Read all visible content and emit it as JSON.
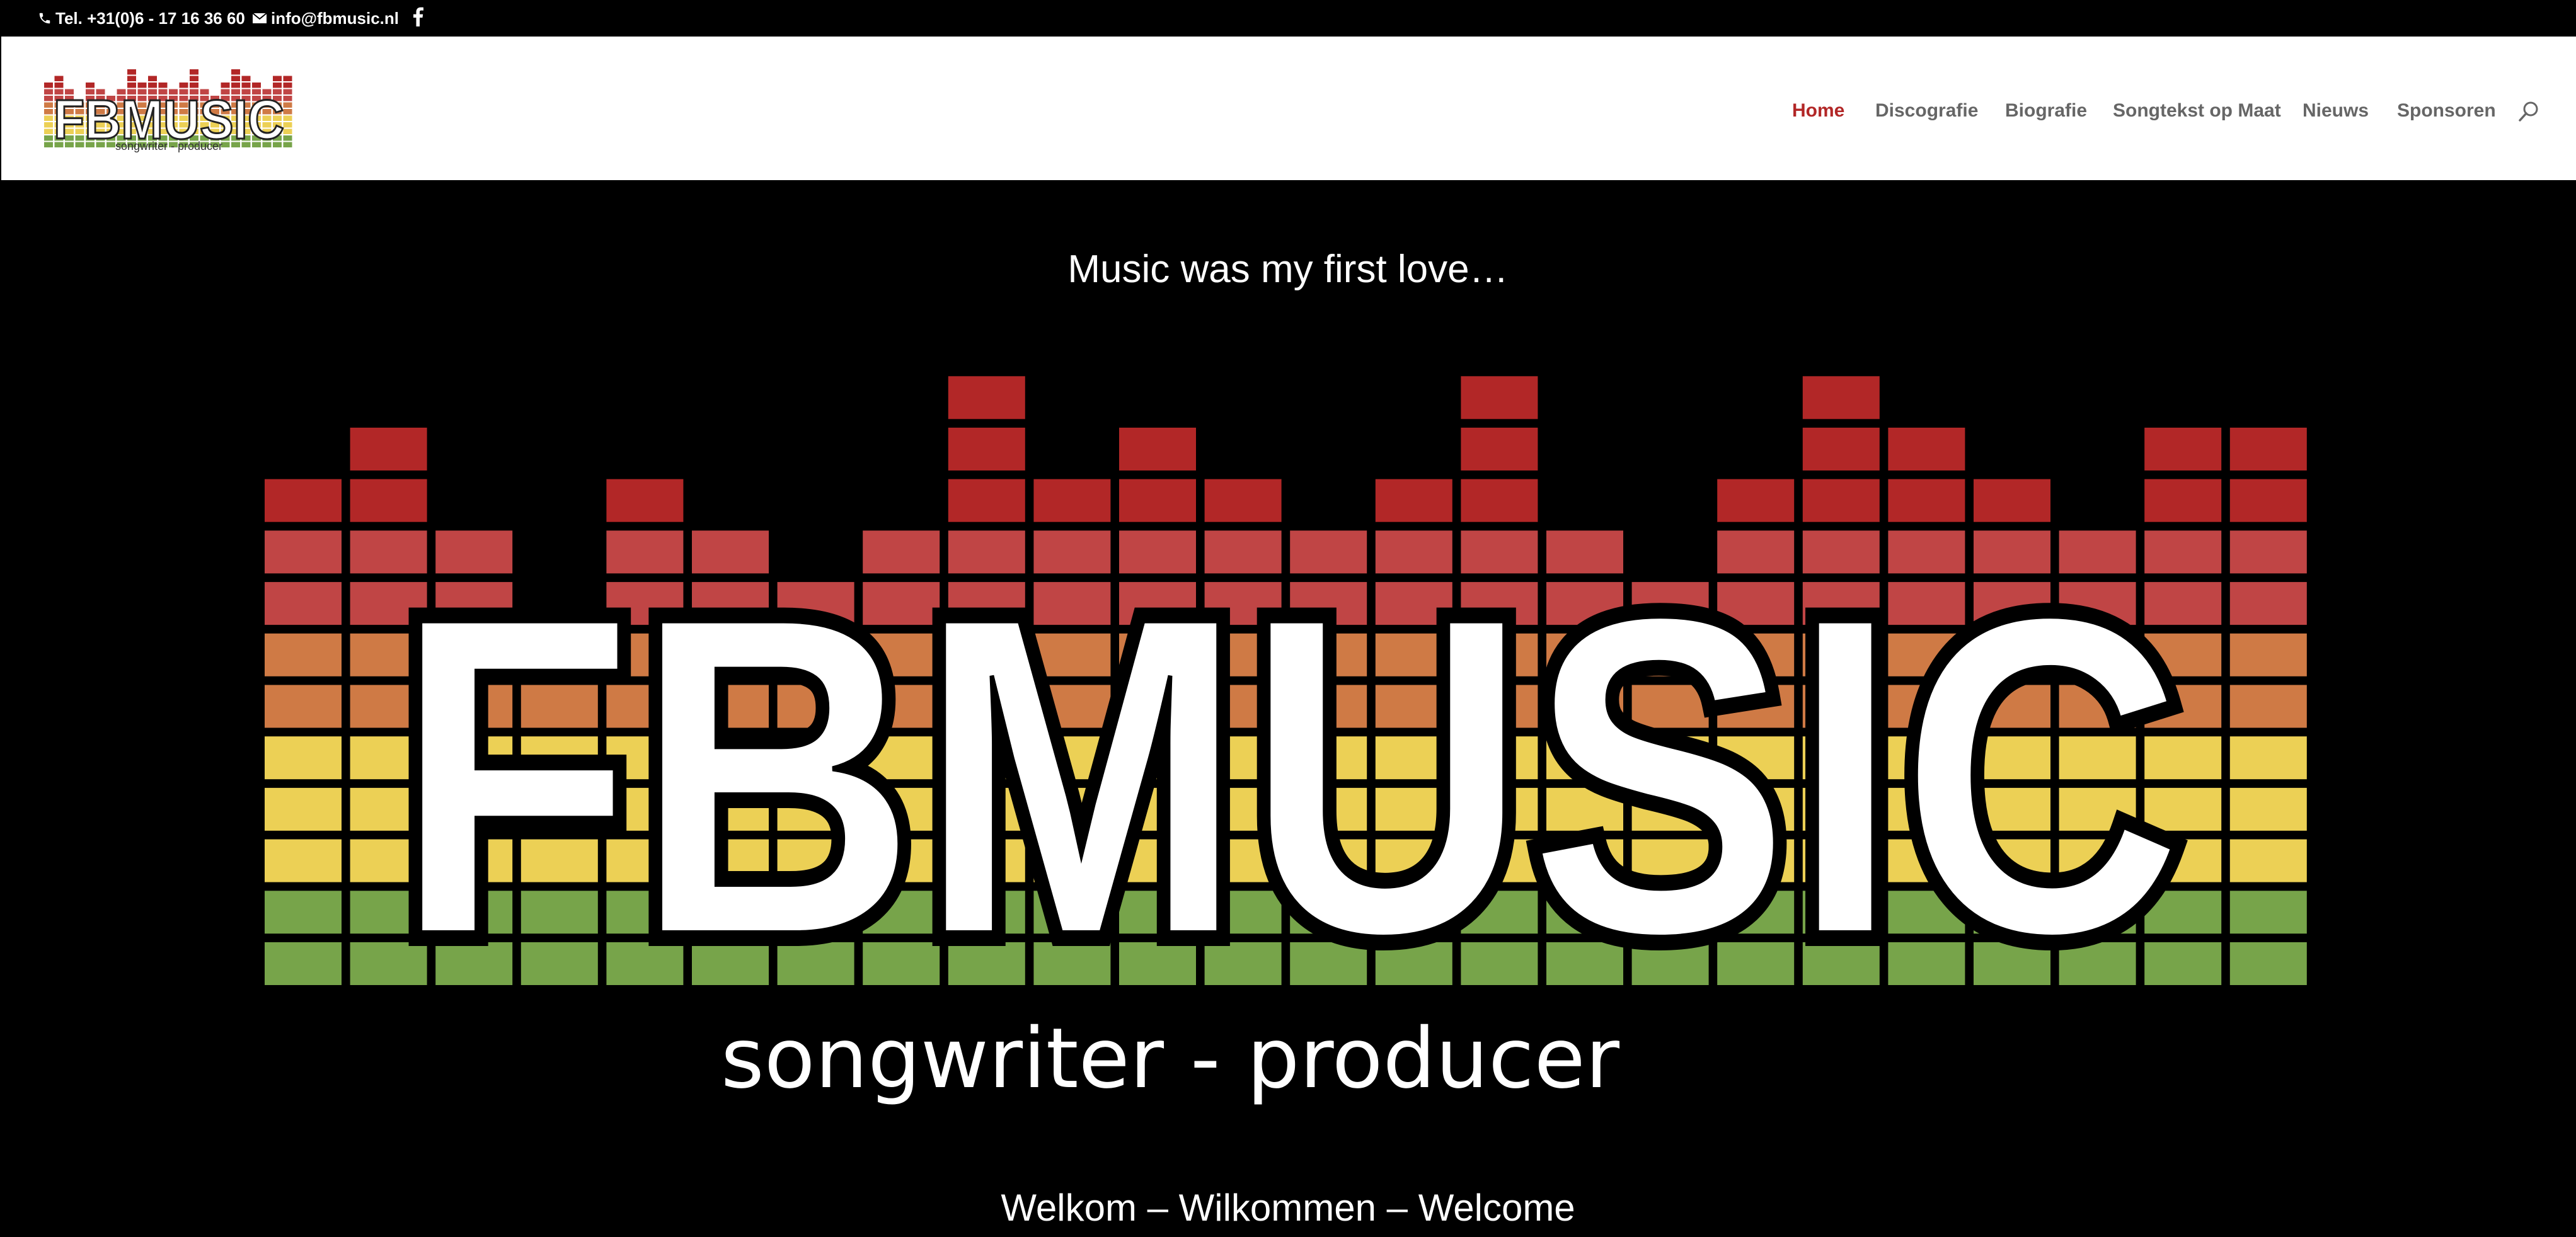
{
  "topbar": {
    "phone": "Tel. +31(0)6 - 17 16 36 60",
    "email": "info@fbmusic.nl",
    "social_icon": "facebook-icon"
  },
  "header": {
    "logo_text": "FBMUSIC",
    "logo_tagline": "songwriter - producer",
    "nav": [
      {
        "label": "Home",
        "active": true
      },
      {
        "label": "Discografie",
        "active": false
      },
      {
        "label": "Biografie",
        "active": false
      },
      {
        "label": "Songtekst op Maat",
        "active": false
      },
      {
        "label": "Nieuws",
        "active": false
      },
      {
        "label": "Sponsoren",
        "active": false
      }
    ],
    "search_icon": "search-icon"
  },
  "hero": {
    "tagline": "Music was my first love…",
    "logo_text": "FBMUSIC",
    "logo_subtitle": "songwriter - producer",
    "welcome": "Welkom – Wilkommen – Welcome"
  },
  "colors": {
    "accent": "#b22727",
    "nav_text": "#666666",
    "eq_rows_top_to_bottom": [
      "#b22727",
      "#b22727",
      "#b22727",
      "#c04545",
      "#c04545",
      "#cf7a45",
      "#cf7a45",
      "#ecd055",
      "#ecd055",
      "#ecd055",
      "#77a44a",
      "#77a44a"
    ]
  },
  "equalizer_column_levels": [
    10,
    11,
    9,
    7,
    10,
    9,
    8,
    9,
    12,
    10,
    11,
    10,
    9,
    10,
    12,
    9,
    8,
    10,
    12,
    11,
    10,
    9,
    11,
    11
  ]
}
